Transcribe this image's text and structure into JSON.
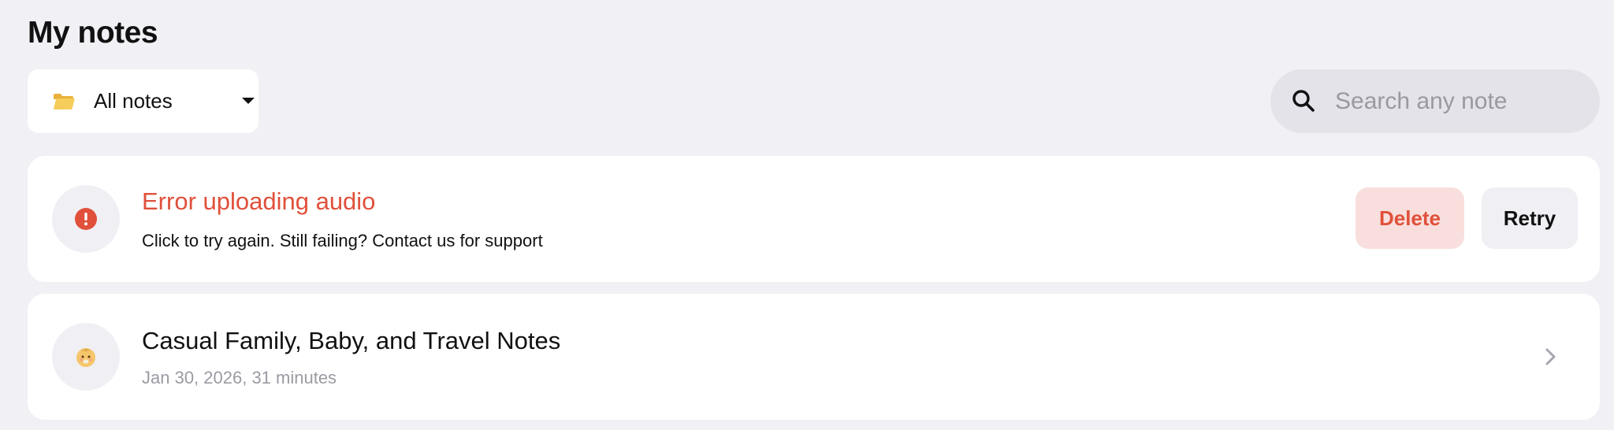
{
  "header": {
    "title": "My notes"
  },
  "filter": {
    "folder_icon": "folder-icon",
    "selected": "All notes",
    "caret_icon": "caret-down-icon"
  },
  "search": {
    "icon": "search-icon",
    "placeholder": "Search any note",
    "value": ""
  },
  "error_card": {
    "icon": "error-icon",
    "title": "Error uploading audio",
    "message": "Click to try again. Still failing? Contact us for support",
    "delete_label": "Delete",
    "retry_label": "Retry"
  },
  "notes": [
    {
      "icon": "baby-emoji-icon",
      "title": "Casual Family, Baby, and Travel Notes",
      "meta": "Jan 30, 2026, 31 minutes"
    }
  ],
  "colors": {
    "background": "#f1f0f5",
    "error": "#e0503a",
    "delete_bg": "#f8dfdd",
    "muted_text": "#9b9aa3"
  }
}
